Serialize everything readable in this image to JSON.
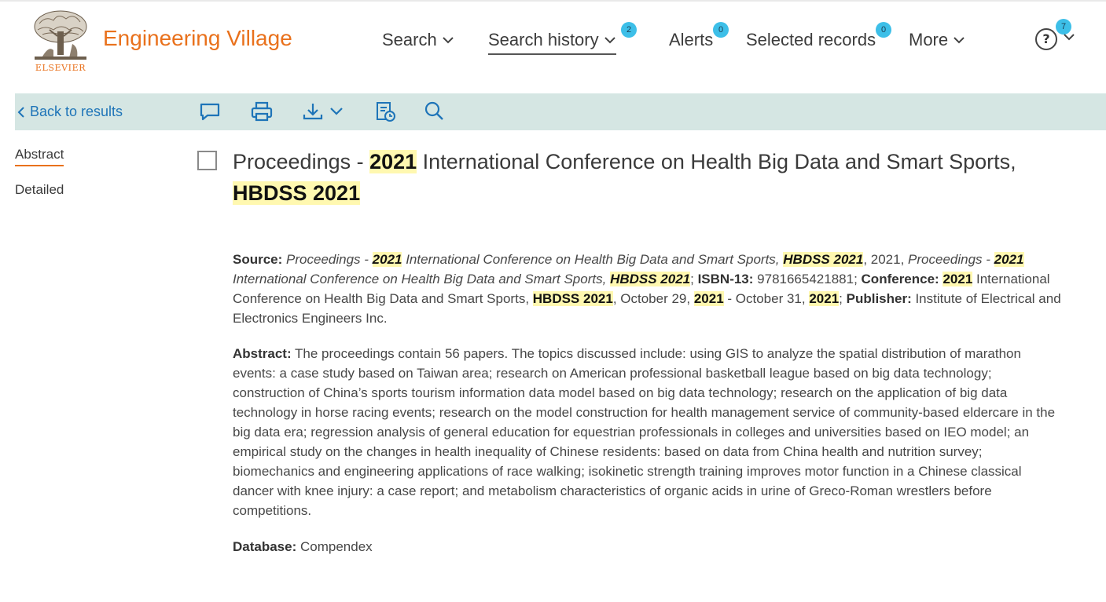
{
  "brand": {
    "publisher_logo_text": "ELSEVIER",
    "app_title": "Engineering Village",
    "accent_color": "#e9711c"
  },
  "nav": {
    "search": "Search",
    "search_history": "Search history",
    "search_history_badge": "2",
    "alerts": "Alerts",
    "alerts_badge": "0",
    "selected_records": "Selected records",
    "selected_records_badge": "0",
    "more": "More",
    "help_badge": "7",
    "help_icon": "?"
  },
  "toolbar": {
    "back_label": "Back to results",
    "icons": [
      "comment-icon",
      "print-icon",
      "download-icon",
      "save-history-icon",
      "search-icon"
    ],
    "background": "#d5e6e3"
  },
  "side_tabs": {
    "abstract": "Abstract",
    "detailed": "Detailed"
  },
  "record": {
    "title_prefix": "Proceedings - ",
    "title_year": "2021",
    "title_mid": " International Conference on Health Big Data and Smart Sports, ",
    "title_acronym": "HBDSS 2021",
    "source_label": "Source:",
    "source": {
      "t1": "Proceedings - ",
      "h1": "2021",
      "t2": " International Conference on Health Big Data and Smart Sports, ",
      "h2": "HBDSS 2021",
      "t3": ", 2021, ",
      "t4": "Proceedings - ",
      "h3": "2021",
      "t5": " International Conference on Health Big Data and Smart Sports, ",
      "h4": "HBDSS 2021",
      "t6": ";  ",
      "isbn_label": "ISBN-13:",
      "isbn": " 9781665421881; ",
      "conf_label": "Conference:",
      "t7": " ",
      "h5": "2021",
      "t8": " International Conference on Health Big Data and Smart Sports, ",
      "h6": "HBDSS 2021",
      "t9": ", October 29, ",
      "h7": "2021",
      "t10": " - October 31, ",
      "h8": "2021",
      "t11": "; ",
      "pub_label": "Publisher:",
      "publisher": " Institute of Electrical and Electronics Engineers Inc."
    },
    "abstract_label": "Abstract:",
    "abstract": " The proceedings contain 56 papers. The topics discussed include: using GIS to analyze the spatial distribution of marathon events: a case study based on Taiwan area; research on American professional basketball league based on big data technology; construction of China’s sports tourism information data model based on big data technology; research on the application of big data technology in horse racing events; research on the model construction for health management service of community-based eldercare in the big data era; regression analysis of general education for equestrian professionals in colleges and universities based on IEO model; an empirical study on the changes in health inequality of Chinese residents: based on data from China health and nutrition survey; biomechanics and engineering applications of race walking; isokinetic strength training improves motor function in a Chinese classical dancer with knee injury: a case report; and metabolism characteristics of organic acids in urine of Greco-Roman wrestlers before competitions.",
    "database_label": "Database:",
    "database": " Compendex",
    "highlight_color": "#fff8b0"
  }
}
